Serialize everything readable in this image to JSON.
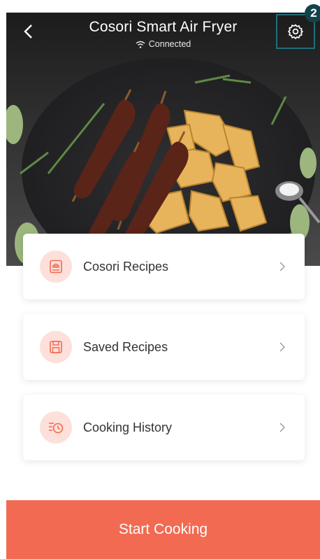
{
  "header": {
    "title": "Cosori Smart Air Fryer",
    "status": "Connected",
    "back_icon": "chevron-left-icon",
    "settings_icon": "gear-icon"
  },
  "step_badge": "2",
  "menu": [
    {
      "label": "Cosori Recipes",
      "icon": "recipe-book-icon"
    },
    {
      "label": "Saved Recipes",
      "icon": "floppy-disk-icon"
    },
    {
      "label": "Cooking History",
      "icon": "history-clock-icon"
    }
  ],
  "cta": {
    "label": "Start Cooking"
  },
  "colors": {
    "accent": "#f26a52",
    "icon_bg": "#fde0da",
    "highlight_border": "#1f6f79",
    "badge": "#14424a"
  }
}
